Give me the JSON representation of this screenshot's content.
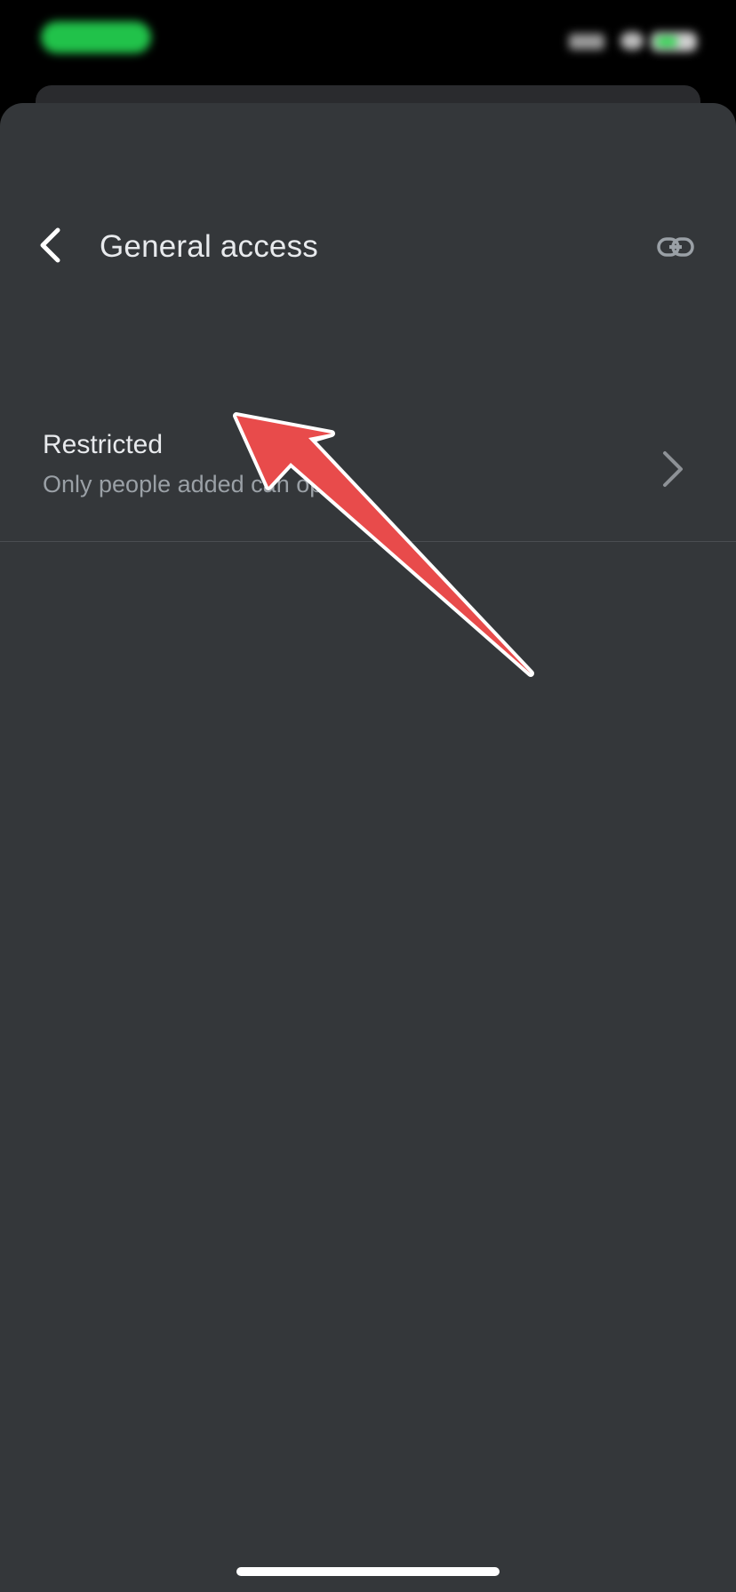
{
  "header": {
    "title": "General access",
    "back_icon": "chevron-left-icon",
    "link_icon": "link-icon"
  },
  "access_row": {
    "title": "Restricted",
    "subtitle": "Only people added can open",
    "chevron_icon": "chevron-right-icon"
  },
  "colors": {
    "sheet_background": "#34373a",
    "primary_text": "#e8eaed",
    "secondary_text": "#9aa0a6",
    "annotation_arrow": "#e84b4b",
    "status_green": "#21c24a"
  }
}
